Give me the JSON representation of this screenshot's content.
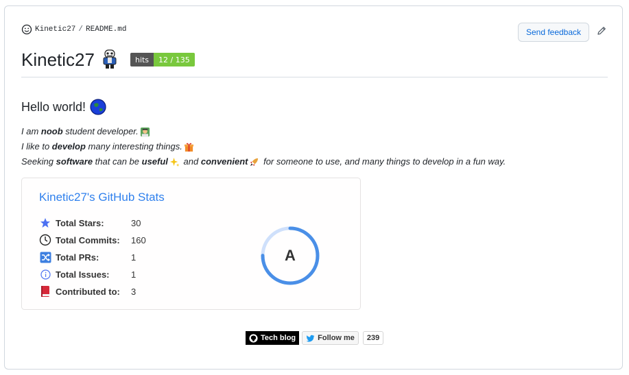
{
  "breadcrumb": {
    "owner": "Kinetic27",
    "separator": "/",
    "file": "README.md"
  },
  "header": {
    "feedback_label": "Send feedback"
  },
  "readme": {
    "title": "Kinetic27",
    "hits_badge": {
      "label": "hits",
      "value": "12 / 135"
    },
    "greeting": "Hello world!",
    "intro_lines": {
      "line1": {
        "a": "I am ",
        "b": "noob",
        "c": " student developer."
      },
      "line2": {
        "a": "I like to ",
        "b": "develop",
        "c": " many interesting things."
      },
      "line3": {
        "a": "Seeking ",
        "b": "software",
        "c": " that can be ",
        "d": "useful",
        "e": " and ",
        "f": "convenient",
        "g": " for someone to use, and many things to develop in a fun way."
      }
    }
  },
  "stats_card": {
    "title": "Kinetic27's GitHub Stats",
    "rows": [
      {
        "label": "Total Stars:",
        "value": "30",
        "icon": "star-icon"
      },
      {
        "label": "Total Commits:",
        "value": "160",
        "icon": "clock-icon"
      },
      {
        "label": "Total PRs:",
        "value": "1",
        "icon": "shuffle-icon"
      },
      {
        "label": "Total Issues:",
        "value": "1",
        "icon": "info-icon"
      },
      {
        "label": "Contributed to:",
        "value": "3",
        "icon": "book-icon"
      }
    ],
    "rank": "A",
    "rank_progress_percent": 75,
    "accent_color": "#2f80ed"
  },
  "footer_badges": {
    "tech_blog": "Tech blog",
    "follow": "Follow me",
    "follow_count": "239"
  }
}
